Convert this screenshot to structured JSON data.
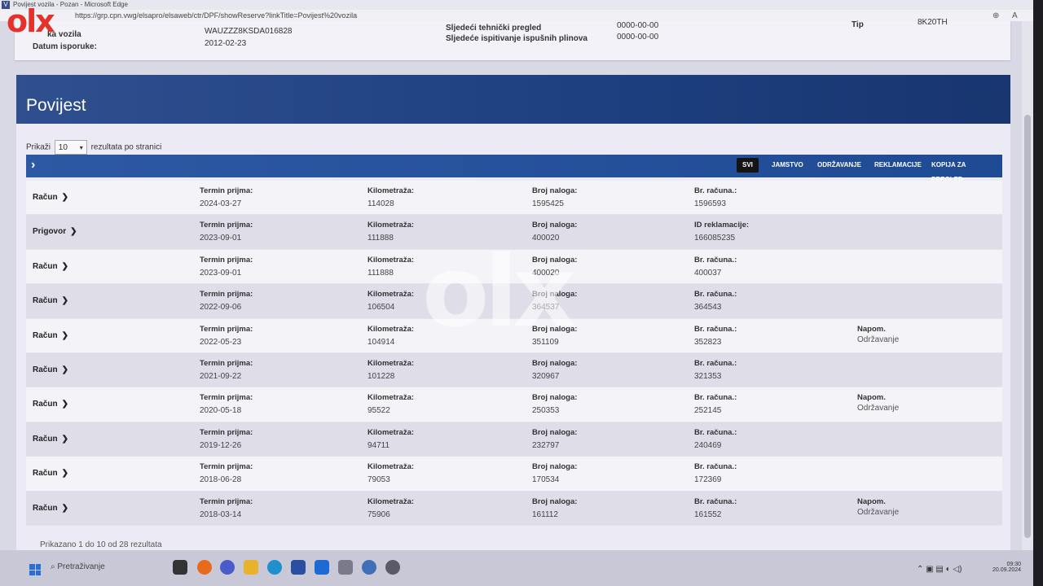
{
  "browser": {
    "title": "Povijest vozila - Pozan - Microsoft Edge",
    "url": "https://grp.cpn.vwg/elsapro/elsaweb/ctr/DPF/showReserve?linkTitle=Povijest%20vozila"
  },
  "vehicle": {
    "vin_label_partial": "ka vozila",
    "vin": "WAUZZZ8KSDA016828",
    "delivery_label": "Datum isporuke:",
    "delivery_date": "2012-02-23",
    "inspection_label": "Sljedeći tehnički pregled",
    "inspection_value": "0000-00-00",
    "emission_label": "Sljedeće ispitivanje ispušnih plinova",
    "emission_value": "0000-00-00",
    "type_label": "Tip",
    "type_value": "8K20TH"
  },
  "history": {
    "title": "Povijest",
    "show_label": "Prikaži",
    "page_size": "10",
    "per_page_label": "rezultata po stranici",
    "filters": [
      "SVI",
      "JAMSTVO",
      "ODRŽAVANJE",
      "REKLAMACIJE",
      "KOPIJA ZA PREGLED"
    ],
    "active_filter": "SVI",
    "summary": "Prikazano 1 do 10 od 28 rezultata"
  },
  "rows": [
    {
      "type": "Račun",
      "l1": "Termin prijma:",
      "date": "2024-03-27",
      "l2": "Kilometraža:",
      "km": "114028",
      "l3": "Broj naloga:",
      "order": "1595425",
      "l4": "Br. računa.:",
      "num": "1596593",
      "note_label": "",
      "note": ""
    },
    {
      "type": "Prigovor",
      "l1": "Termin prijma:",
      "date": "2023-09-01",
      "l2": "Kilometraža:",
      "km": "111888",
      "l3": "Broj naloga:",
      "order": "400020",
      "l4": "ID reklamacije:",
      "num": "166085235",
      "note_label": "",
      "note": ""
    },
    {
      "type": "Račun",
      "l1": "Termin prijma:",
      "date": "2023-09-01",
      "l2": "Kilometraža:",
      "km": "111888",
      "l3": "Broj naloga:",
      "order": "400020",
      "l4": "Br. računa.:",
      "num": "400037",
      "note_label": "",
      "note": ""
    },
    {
      "type": "Račun",
      "l1": "Termin prijma:",
      "date": "2022-09-06",
      "l2": "Kilometraža:",
      "km": "106504",
      "l3": "Broj naloga:",
      "order": "364537",
      "l4": "Br. računa.:",
      "num": "364543",
      "note_label": "",
      "note": ""
    },
    {
      "type": "Račun",
      "l1": "Termin prijma:",
      "date": "2022-05-23",
      "l2": "Kilometraža:",
      "km": "104914",
      "l3": "Broj naloga:",
      "order": "351109",
      "l4": "Br. računa.:",
      "num": "352823",
      "note_label": "Napom.",
      "note": "Održavanje"
    },
    {
      "type": "Račun",
      "l1": "Termin prijma:",
      "date": "2021-09-22",
      "l2": "Kilometraža:",
      "km": "101228",
      "l3": "Broj naloga:",
      "order": "320967",
      "l4": "Br. računa.:",
      "num": "321353",
      "note_label": "",
      "note": ""
    },
    {
      "type": "Račun",
      "l1": "Termin prijma:",
      "date": "2020-05-18",
      "l2": "Kilometraža:",
      "km": "95522",
      "l3": "Broj naloga:",
      "order": "250353",
      "l4": "Br. računa.:",
      "num": "252145",
      "note_label": "Napom.",
      "note": "Održavanje"
    },
    {
      "type": "Račun",
      "l1": "Termin prijma:",
      "date": "2019-12-26",
      "l2": "Kilometraža:",
      "km": "94711",
      "l3": "Broj naloga:",
      "order": "232797",
      "l4": "Br. računa.:",
      "num": "240469",
      "note_label": "",
      "note": ""
    },
    {
      "type": "Račun",
      "l1": "Termin prijma:",
      "date": "2018-06-28",
      "l2": "Kilometraža:",
      "km": "79053",
      "l3": "Broj naloga:",
      "order": "170534",
      "l4": "Br. računa.:",
      "num": "172369",
      "note_label": "",
      "note": ""
    },
    {
      "type": "Račun",
      "l1": "Termin prijma:",
      "date": "2018-03-14",
      "l2": "Kilometraža:",
      "km": "75906",
      "l3": "Broj naloga:",
      "order": "161112",
      "l4": "Br. računa.:",
      "num": "161552",
      "note_label": "Napom.",
      "note": "Održavanje"
    }
  ],
  "taskbar": {
    "search_placeholder": "Pretraživanje",
    "time": "09:30",
    "date": "20.09.2024"
  },
  "watermark": {
    "text": "olx"
  },
  "colors": {
    "header_blue": "#1d3f7f",
    "filter_blue": "#2d58a3",
    "olx_red": "#e4322b"
  }
}
